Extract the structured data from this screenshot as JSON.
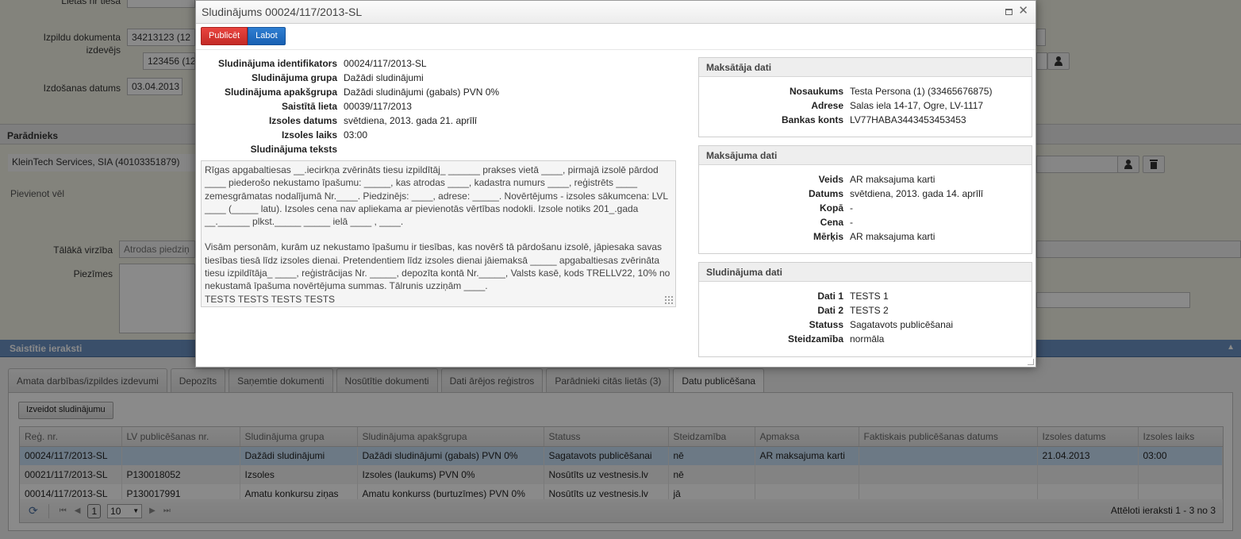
{
  "background": {
    "case_no_label": "Lietas nr tiesā",
    "issuer_label": "Izpildu dokumenta izdevējs",
    "issuer_value_1": "34213123 (12",
    "issuer_value_2": "123456 (12",
    "issue_date_label": "Izdošanas datums",
    "issue_date_value": "03.04.2013",
    "debtor_section": "Parādnieks",
    "debtor_value": "KleinTech Services, SIA (40103351879)",
    "add_more_link": "Pievienot vēl",
    "next_step_label": "Tālākā virzība",
    "next_step_value": "Atrodas piedziņ",
    "notes_label": "Piezīmes"
  },
  "linked": {
    "header": "Saistītie ieraksti",
    "tabs": [
      {
        "label": "Amata darbības/izpildes izdevumi",
        "active": false
      },
      {
        "label": "Depozīts",
        "active": false
      },
      {
        "label": "Saņemtie dokumenti",
        "active": false
      },
      {
        "label": "Nosūtītie dokumenti",
        "active": false
      },
      {
        "label": "Dati ārējos reģistros",
        "active": false
      },
      {
        "label": "Parādnieki citās lietās (3)",
        "active": false
      },
      {
        "label": "Datu publicēšana",
        "active": true
      }
    ],
    "create_button": "Izveidot sludinājumu",
    "columns": [
      "Reģ. nr.",
      "LV publicēšanas nr.",
      "Sludinājuma grupa",
      "Sludinājuma apakšgrupa",
      "Statuss",
      "Steidzamība",
      "Apmaksa",
      "Faktiskais publicēšanas datums",
      "Izsoles datums",
      "Izsoles laiks"
    ],
    "rows": [
      [
        "00024/117/2013-SL",
        "",
        "Dažādi sludinājumi",
        "Dažādi sludinājumi (gabals) PVN 0%",
        "Sagatavots publicēšanai",
        "nē",
        "AR maksajuma karti",
        "",
        "21.04.2013",
        "03:00"
      ],
      [
        "00021/117/2013-SL",
        "P130018052",
        "Izsoles",
        "Izsoles (laukums) PVN 0%",
        "Nosūtīts uz vestnesis.lv",
        "nē",
        "",
        "",
        "",
        ""
      ],
      [
        "00014/117/2013-SL",
        "P130017991",
        "Amatu konkursu ziņas",
        "Amatu konkurss (burtuzīmes) PVN 0%",
        "Nosūtīts uz vestnesis.lv",
        "jā",
        "",
        "",
        "",
        ""
      ]
    ],
    "pager": {
      "page": "1",
      "page_size": "10",
      "info": "Attēloti ieraksti 1 - 3 no 3"
    }
  },
  "modal": {
    "title": "Sludinājums 00024/117/2013-SL",
    "publish_button": "Publicēt",
    "edit_button": "Labot",
    "fields": [
      {
        "label": "Sludinājuma identifikators",
        "value": "00024/117/2013-SL",
        "link": false
      },
      {
        "label": "Sludinājuma grupa",
        "value": "Dažādi sludinājumi",
        "link": false
      },
      {
        "label": "Sludinājuma apakšgrupa",
        "value": "Dažādi sludinājumi (gabals) PVN 0%",
        "link": false
      },
      {
        "label": "Saistītā lieta",
        "value": "00039/117/2013",
        "link": true
      },
      {
        "label": "Izsoles datums",
        "value": "svētdiena, 2013. gada 21. aprīlī",
        "link": false
      },
      {
        "label": "Izsoles laiks",
        "value": "03:00",
        "link": false
      },
      {
        "label": "Sludinājuma teksts",
        "value": "",
        "link": false
      }
    ],
    "text_paragraphs": [
      "Rīgas apgabaltiesas __.iecirkņa zvērināts tiesu izpildītāj_ ______ prakses vietā ____, pirmajā izsolē pārdod ____ piederošo nekustamo īpašumu: _____, kas atrodas ____, kadastra numurs ____, reģistrēts ____ zemesgrāmatas nodalījumā Nr.____. Piedzinējs: ____, adrese: _____. Novērtējums - izsoles sākumcena: LVL ____ (_____ latu). Izsoles cena nav apliekama ar pievienotās vērtības nodokli. Izsole notiks 201_.gada __.______ plkst._____ _____ ielā ____ , ____.",
      "Visām personām, kurām uz nekustamo īpašumu ir tiesības, kas novērš tā pārdošanu izsolē, jāpiesaka savas tiesības tiesā līdz izsoles dienai. Pretendentiem līdz izsoles dienai jāiemaksā _____ apgabaltiesas zvērināta tiesu izpildītāja_ ____, reģistrācijas Nr. _____, depozīta kontā Nr._____, Valsts kasē, kods TRELLV22, 10% no nekustamā īpašuma novērtējuma summas. Tālrunis uzziņām ____.",
      "TESTS TESTS TESTS TESTS"
    ],
    "panels": [
      {
        "title": "Maksātāja dati",
        "rows": [
          {
            "label": "Nosaukums",
            "value": "Testa Persona (1) (33465676875)",
            "link": true
          },
          {
            "label": "Adrese",
            "value": "Salas iela 14-17, Ogre, LV-1117",
            "link": false
          },
          {
            "label": "Bankas konts",
            "value": "LV77HABA3443453453453",
            "link": false
          }
        ]
      },
      {
        "title": "Maksājuma dati",
        "rows": [
          {
            "label": "Veids",
            "value": "AR maksajuma karti",
            "link": false
          },
          {
            "label": "Datums",
            "value": "svētdiena, 2013. gada 14. aprīlī",
            "link": false
          },
          {
            "label": "Kopā",
            "value": "-",
            "link": false
          },
          {
            "label": "Cena",
            "value": "-",
            "link": false
          },
          {
            "label": "Mērķis",
            "value": "AR maksajuma karti",
            "link": false
          }
        ]
      },
      {
        "title": "Sludinājuma dati",
        "rows": [
          {
            "label": "Dati 1",
            "value": "TESTS 1",
            "link": false
          },
          {
            "label": "Dati 2",
            "value": "TESTS 2",
            "link": false
          },
          {
            "label": "Statuss",
            "value": "Sagatavots publicēšanai",
            "link": false
          },
          {
            "label": "Steidzamība",
            "value": "normāla",
            "link": false
          }
        ]
      }
    ]
  },
  "colors": {
    "publish": "#d9342f",
    "edit": "#1f6fc4",
    "link": "#1f72b8",
    "section_header": "#6c93c4",
    "selected_row": "#c7dff5"
  }
}
